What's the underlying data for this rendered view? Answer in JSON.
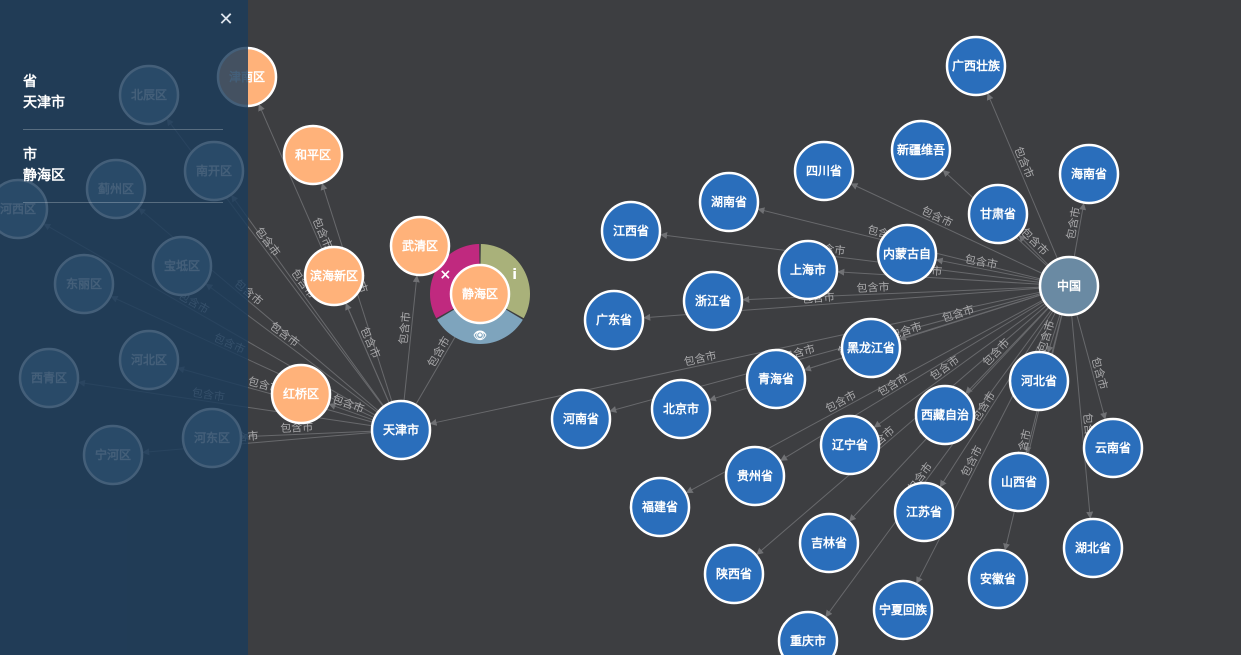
{
  "panel": {
    "close_icon": "close-icon",
    "fields": [
      {
        "key": "省",
        "value": "天津市"
      },
      {
        "key": "市",
        "value": "静海区"
      }
    ]
  },
  "edge_label": "包含市",
  "colors": {
    "background": "#3d3e41",
    "province_node": "#2a6ebb",
    "district_node": "#ffb27a",
    "root_node": "#6a8aa3",
    "ring_remove": "#c0297f",
    "ring_info": "#a9b17a",
    "ring_view": "#7ea4bd"
  },
  "radial_menu": {
    "remove_icon": "close-icon",
    "info_icon": "info-icon",
    "view_icon": "eye-icon"
  },
  "nodes": [
    {
      "id": "china",
      "label": "中国",
      "type": "root"
    },
    {
      "id": "guangxi",
      "label": "广西壮族",
      "type": "province"
    },
    {
      "id": "xinjiang",
      "label": "新疆维吾",
      "type": "province"
    },
    {
      "id": "hainan",
      "label": "海南省",
      "type": "province"
    },
    {
      "id": "sichuan",
      "label": "四川省",
      "type": "province"
    },
    {
      "id": "gansu",
      "label": "甘肃省",
      "type": "province"
    },
    {
      "id": "hunan",
      "label": "湖南省",
      "type": "province"
    },
    {
      "id": "jiangxi",
      "label": "江西省",
      "type": "province"
    },
    {
      "id": "neimenggu",
      "label": "内蒙古自",
      "type": "province"
    },
    {
      "id": "shanghai",
      "label": "上海市",
      "type": "province"
    },
    {
      "id": "zhejiang",
      "label": "浙江省",
      "type": "province"
    },
    {
      "id": "guangdong",
      "label": "广东省",
      "type": "province"
    },
    {
      "id": "heilongjiang",
      "label": "黑龙江省",
      "type": "province"
    },
    {
      "id": "qinghai",
      "label": "青海省",
      "type": "province"
    },
    {
      "id": "hebei",
      "label": "河北省",
      "type": "province"
    },
    {
      "id": "xizang",
      "label": "西藏自治",
      "type": "province"
    },
    {
      "id": "beijing",
      "label": "北京市",
      "type": "province"
    },
    {
      "id": "henan",
      "label": "河南省",
      "type": "province"
    },
    {
      "id": "yunnan",
      "label": "云南省",
      "type": "province"
    },
    {
      "id": "liaoning",
      "label": "辽宁省",
      "type": "province"
    },
    {
      "id": "shanxi",
      "label": "山西省",
      "type": "province"
    },
    {
      "id": "guizhou",
      "label": "贵州省",
      "type": "province"
    },
    {
      "id": "fujian",
      "label": "福建省",
      "type": "province"
    },
    {
      "id": "jiangsu",
      "label": "江苏省",
      "type": "province"
    },
    {
      "id": "hubei",
      "label": "湖北省",
      "type": "province"
    },
    {
      "id": "jilin",
      "label": "吉林省",
      "type": "province"
    },
    {
      "id": "anhui",
      "label": "安徽省",
      "type": "province"
    },
    {
      "id": "shaanxi",
      "label": "陕西省",
      "type": "province"
    },
    {
      "id": "ningxia",
      "label": "宁夏回族",
      "type": "province"
    },
    {
      "id": "chongqing",
      "label": "重庆市",
      "type": "province"
    },
    {
      "id": "tianjin",
      "label": "天津市",
      "type": "province"
    },
    {
      "id": "jinnan",
      "label": "津南区",
      "type": "district"
    },
    {
      "id": "heping",
      "label": "和平区",
      "type": "district"
    },
    {
      "id": "binhai",
      "label": "滨海新区",
      "type": "district"
    },
    {
      "id": "wuqing",
      "label": "武清区",
      "type": "district"
    },
    {
      "id": "jinghai",
      "label": "静海区",
      "type": "district"
    },
    {
      "id": "hongqiao",
      "label": "红桥区",
      "type": "district"
    },
    {
      "id": "beichen",
      "label": "北辰区",
      "type": "faded"
    },
    {
      "id": "nankai",
      "label": "南开区",
      "type": "faded"
    },
    {
      "id": "jizhou",
      "label": "蓟州区",
      "type": "faded"
    },
    {
      "id": "hexi",
      "label": "河西区",
      "type": "faded"
    },
    {
      "id": "baodi",
      "label": "宝坻区",
      "type": "faded"
    },
    {
      "id": "dongli",
      "label": "东丽区",
      "type": "faded"
    },
    {
      "id": "hebeiqu",
      "label": "河北区",
      "type": "faded"
    },
    {
      "id": "xiqing",
      "label": "西青区",
      "type": "faded"
    },
    {
      "id": "hedong",
      "label": "河东区",
      "type": "faded"
    },
    {
      "id": "ninghe",
      "label": "宁河区",
      "type": "faded"
    }
  ]
}
